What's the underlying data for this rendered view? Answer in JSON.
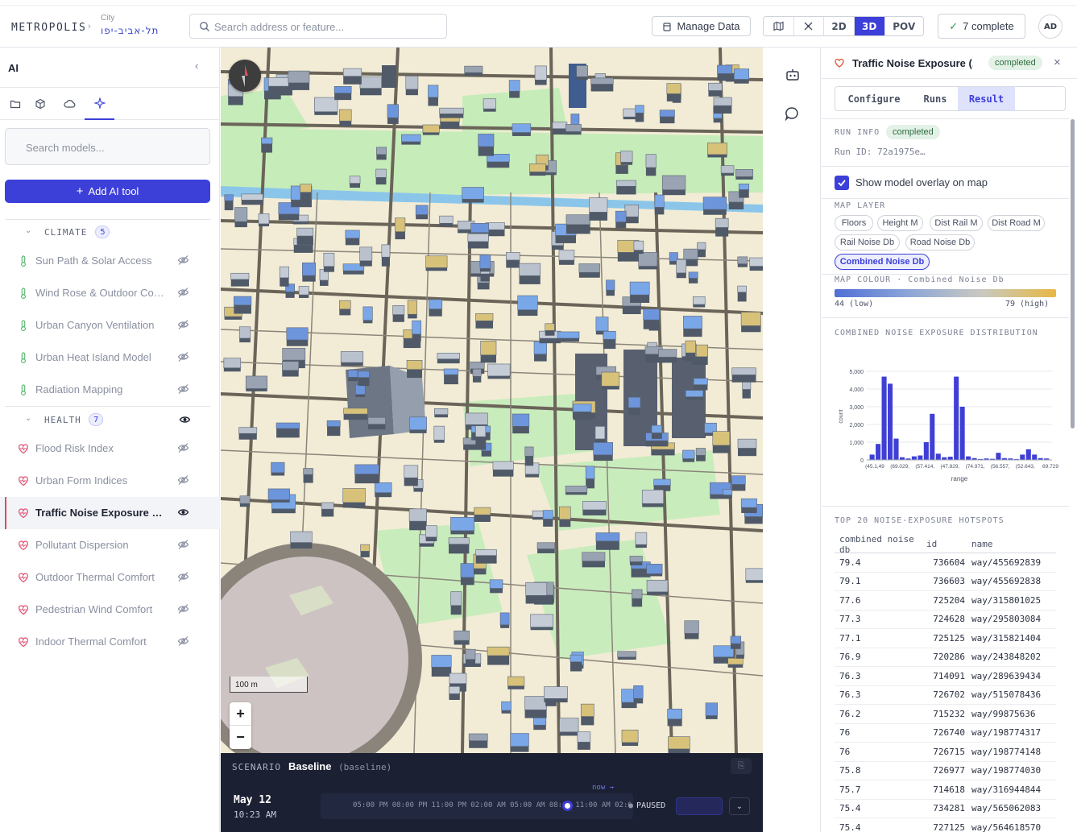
{
  "app": {
    "brand": "METROPOLIS",
    "city_label": "City",
    "city_name": "תל-אביב-יפו"
  },
  "search": {
    "placeholder": "Search address or feature..."
  },
  "toolbar": {
    "manage_label": "Manage Data",
    "view_modes": [
      "",
      "",
      "2D",
      "3D",
      "POV"
    ],
    "active_view": "3D",
    "complete_label": "7 complete",
    "avatar_initials": "AD",
    "accent": "#3c3fd8"
  },
  "left": {
    "title": "AI",
    "tabs": [
      "folder-icon",
      "cube-icon",
      "cloud-icon",
      "sparkles-icon"
    ],
    "search_placeholder": "Search models...",
    "add_label": "Add AI tool",
    "groups": [
      {
        "name": "CLIMATE",
        "count": "5",
        "items": [
          {
            "label": "Sun Path & Solar Access",
            "icon": "thermometer-icon",
            "visible": false
          },
          {
            "label": "Wind Rose & Outdoor Comfort",
            "icon": "thermometer-icon",
            "visible": false
          },
          {
            "label": "Urban Canyon Ventilation",
            "icon": "thermometer-icon",
            "visible": false
          },
          {
            "label": "Urban Heat Island Model",
            "icon": "thermometer-icon",
            "visible": false
          },
          {
            "label": "Radiation Mapping",
            "icon": "thermometer-icon",
            "visible": false
          }
        ]
      },
      {
        "name": "HEALTH",
        "count": "7",
        "items": [
          {
            "label": "Flood Risk Index",
            "icon": "heart-pulse-icon",
            "visible": false
          },
          {
            "label": "Urban Form Indices",
            "icon": "heart-pulse-icon",
            "visible": false
          },
          {
            "label": "Traffic Noise Exposure Model",
            "icon": "heart-pulse-icon",
            "visible": true,
            "active": true
          },
          {
            "label": "Pollutant Dispersion",
            "icon": "heart-pulse-icon",
            "visible": false
          },
          {
            "label": "Outdoor Thermal Comfort",
            "icon": "heart-pulse-icon",
            "visible": false
          },
          {
            "label": "Pedestrian Wind Comfort",
            "icon": "heart-pulse-icon",
            "visible": false
          },
          {
            "label": "Indoor Thermal Comfort",
            "icon": "heart-pulse-icon",
            "visible": false
          }
        ]
      }
    ]
  },
  "map": {
    "scale_label": "100 m"
  },
  "scenario": {
    "label": "SCENARIO",
    "name": "Baseline",
    "tag": "(baseline)",
    "date": "May 12",
    "time": "10:23 AM",
    "timeline_ticks": "05:00 PM 08:00 PM 11:00 PM 02:00 AM 05:00 AM 08:00   11:00 AM 02:00",
    "now_label": "now →",
    "state": "PAUSED"
  },
  "right": {
    "title": "Traffic Noise Exposure (...",
    "status": "completed",
    "tabs": [
      "Configure",
      "Runs",
      "Result"
    ],
    "active_tab": "Result",
    "run_info_label": "RUN INFO",
    "run_status": "completed",
    "run_id": "Run ID: 72a1975e…",
    "overlay_label": "Show model overlay on map",
    "map_layer_label": "MAP LAYER",
    "layers": [
      "Floors",
      "Height M",
      "Dist Rail M",
      "Dist Road M",
      "Rail Noise Db",
      "Road Noise Db",
      "Combined Noise Db"
    ],
    "active_layer": "Combined Noise Db",
    "colour_label": "MAP COLOUR · Combined Noise Db",
    "low_label": "44 (low)",
    "high_label": "79 (high)",
    "dist_label": "COMBINED NOISE EXPOSURE DISTRIBUTION",
    "hotspots_label": "TOP 20 NOISE-EXPOSURE HOTSPOTS",
    "table": {
      "columns": [
        "combined noise db",
        "id",
        "name"
      ],
      "rows": [
        [
          "79.4",
          "736604",
          "way/455692839"
        ],
        [
          "79.1",
          "736603",
          "way/455692838"
        ],
        [
          "77.6",
          "725204",
          "way/315801025"
        ],
        [
          "77.3",
          "724628",
          "way/295803084"
        ],
        [
          "77.1",
          "725125",
          "way/315821404"
        ],
        [
          "76.9",
          "720286",
          "way/243848202"
        ],
        [
          "76.3",
          "714091",
          "way/289639434"
        ],
        [
          "76.3",
          "726702",
          "way/515078436"
        ],
        [
          "76.2",
          "715232",
          "way/99875636"
        ],
        [
          "76",
          "726740",
          "way/198774317"
        ],
        [
          "76",
          "726715",
          "way/198774148"
        ],
        [
          "75.8",
          "726977",
          "way/198774030"
        ],
        [
          "75.7",
          "714618",
          "way/316944844"
        ],
        [
          "75.4",
          "734281",
          "way/565062083"
        ],
        [
          "75.4",
          "727125",
          "way/564618570"
        ]
      ]
    }
  },
  "chart_data": {
    "type": "bar",
    "xlabel": "range",
    "ylabel": "count",
    "ylim": [
      0,
      5000
    ],
    "y_ticks": [
      "0",
      "1,000",
      "2,000",
      "3,000",
      "4,000",
      "5,000"
    ],
    "x_tick_labels": [
      "(45.1,49",
      "(69.029,",
      "(57.414,",
      "(47.829,",
      "(74.971,",
      "(56.557,",
      "(52.643,",
      "69.729"
    ],
    "values": [
      300,
      900,
      4700,
      4300,
      1200,
      150,
      80,
      200,
      250,
      1000,
      2600,
      350,
      150,
      180,
      4700,
      3000,
      200,
      100,
      50,
      80,
      60,
      400,
      100,
      80,
      50,
      300,
      600,
      300,
      100,
      80
    ],
    "grid": true
  }
}
